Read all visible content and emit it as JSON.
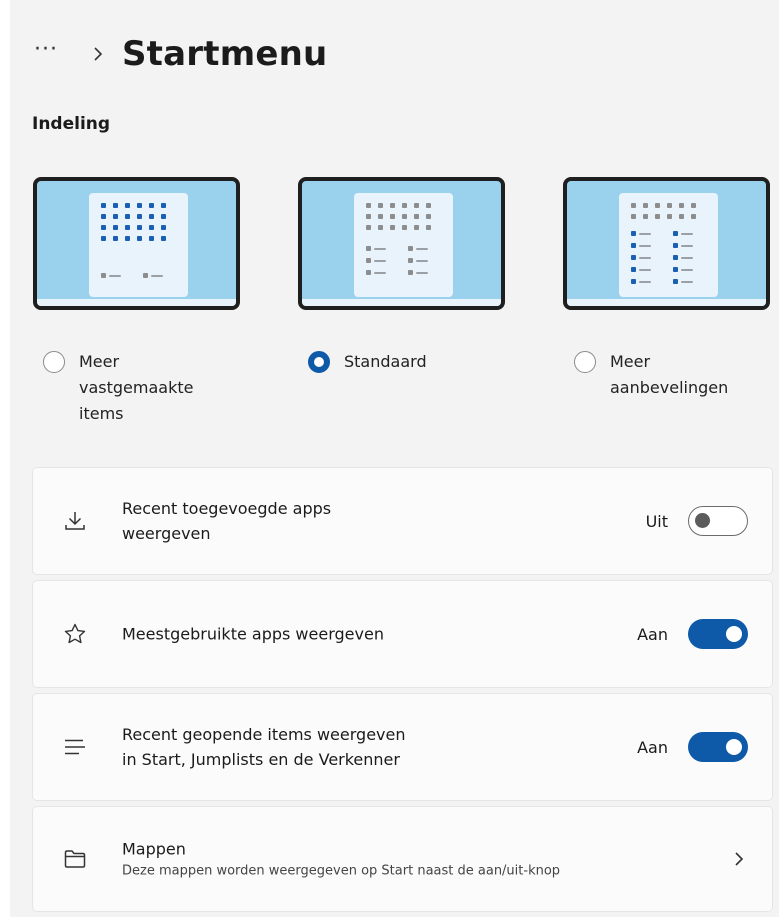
{
  "header": {
    "more_label": "···",
    "title": "Startmenu"
  },
  "section": {
    "label": "Indeling"
  },
  "layouts": [
    {
      "label_lines": [
        "Meer",
        "vastgemaakte",
        "items"
      ],
      "selected": false
    },
    {
      "label_lines": [
        "Standaard"
      ],
      "selected": true
    },
    {
      "label_lines": [
        "Meer",
        "aanbevelingen"
      ],
      "selected": false
    }
  ],
  "settings": [
    {
      "icon": "download-icon",
      "lines": [
        "Recent toegevoegde apps",
        "weergeven"
      ],
      "state_label": "Uit",
      "on": false
    },
    {
      "icon": "star-icon",
      "lines": [
        "Meestgebruikte apps weergeven"
      ],
      "state_label": "Aan",
      "on": true
    },
    {
      "icon": "list-icon",
      "lines": [
        "Recent geopende items weergeven",
        "in Start, Jumplists en de Verkenner"
      ],
      "state_label": "Aan",
      "on": true
    }
  ],
  "folders": {
    "icon": "folder-icon",
    "title": "Mappen",
    "subtitle": "Deze mappen worden weergegeven op Start naast de aan/uit-knop"
  },
  "colors": {
    "accent": "#0f5aa8",
    "preview_bg": "#9ad2ee",
    "page_bg": "#f3f3f3",
    "card_bg": "#fbfbfb"
  }
}
